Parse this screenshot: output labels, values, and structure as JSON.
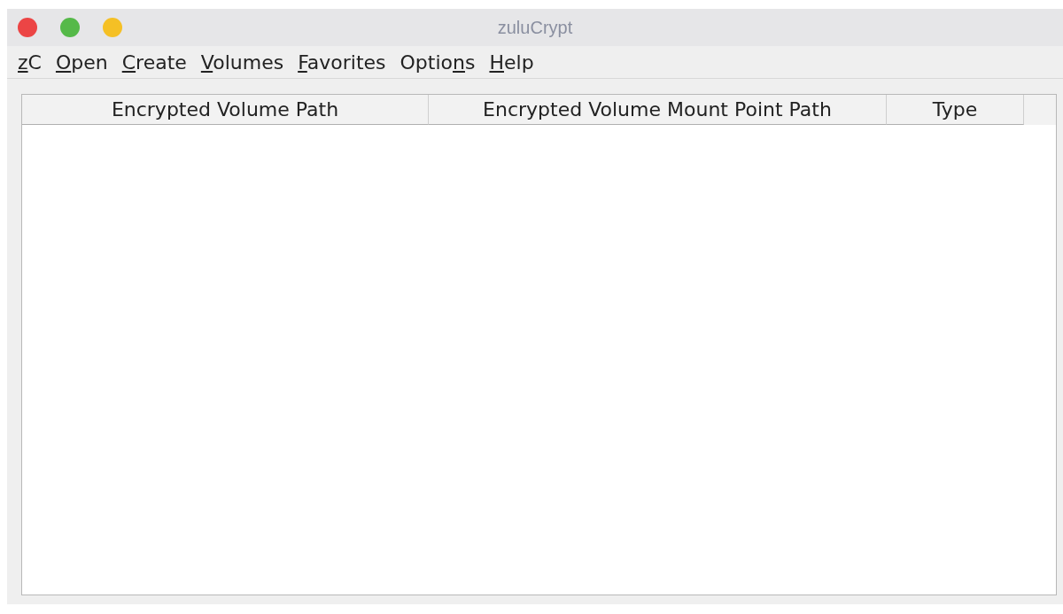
{
  "window": {
    "title": "zuluCrypt"
  },
  "menu": [
    {
      "parts": [
        {
          "text": "z",
          "underlined": true
        },
        {
          "text": "C",
          "underlined": false
        }
      ]
    },
    {
      "parts": [
        {
          "text": "O",
          "underlined": true
        },
        {
          "text": "pen",
          "underlined": false
        }
      ]
    },
    {
      "parts": [
        {
          "text": "C",
          "underlined": true
        },
        {
          "text": "reate",
          "underlined": false
        }
      ]
    },
    {
      "parts": [
        {
          "text": "V",
          "underlined": true
        },
        {
          "text": "olumes",
          "underlined": false
        }
      ]
    },
    {
      "parts": [
        {
          "text": "F",
          "underlined": true
        },
        {
          "text": "avorites",
          "underlined": false
        }
      ]
    },
    {
      "parts": [
        {
          "text": "Optio",
          "underlined": false
        },
        {
          "text": "n",
          "underlined": true
        },
        {
          "text": "s",
          "underlined": false
        }
      ]
    },
    {
      "parts": [
        {
          "text": "H",
          "underlined": true
        },
        {
          "text": "elp",
          "underlined": false
        }
      ]
    }
  ],
  "table": {
    "columns": [
      "Encrypted Volume Path",
      "Encrypted Volume Mount Point Path",
      "Type"
    ]
  }
}
